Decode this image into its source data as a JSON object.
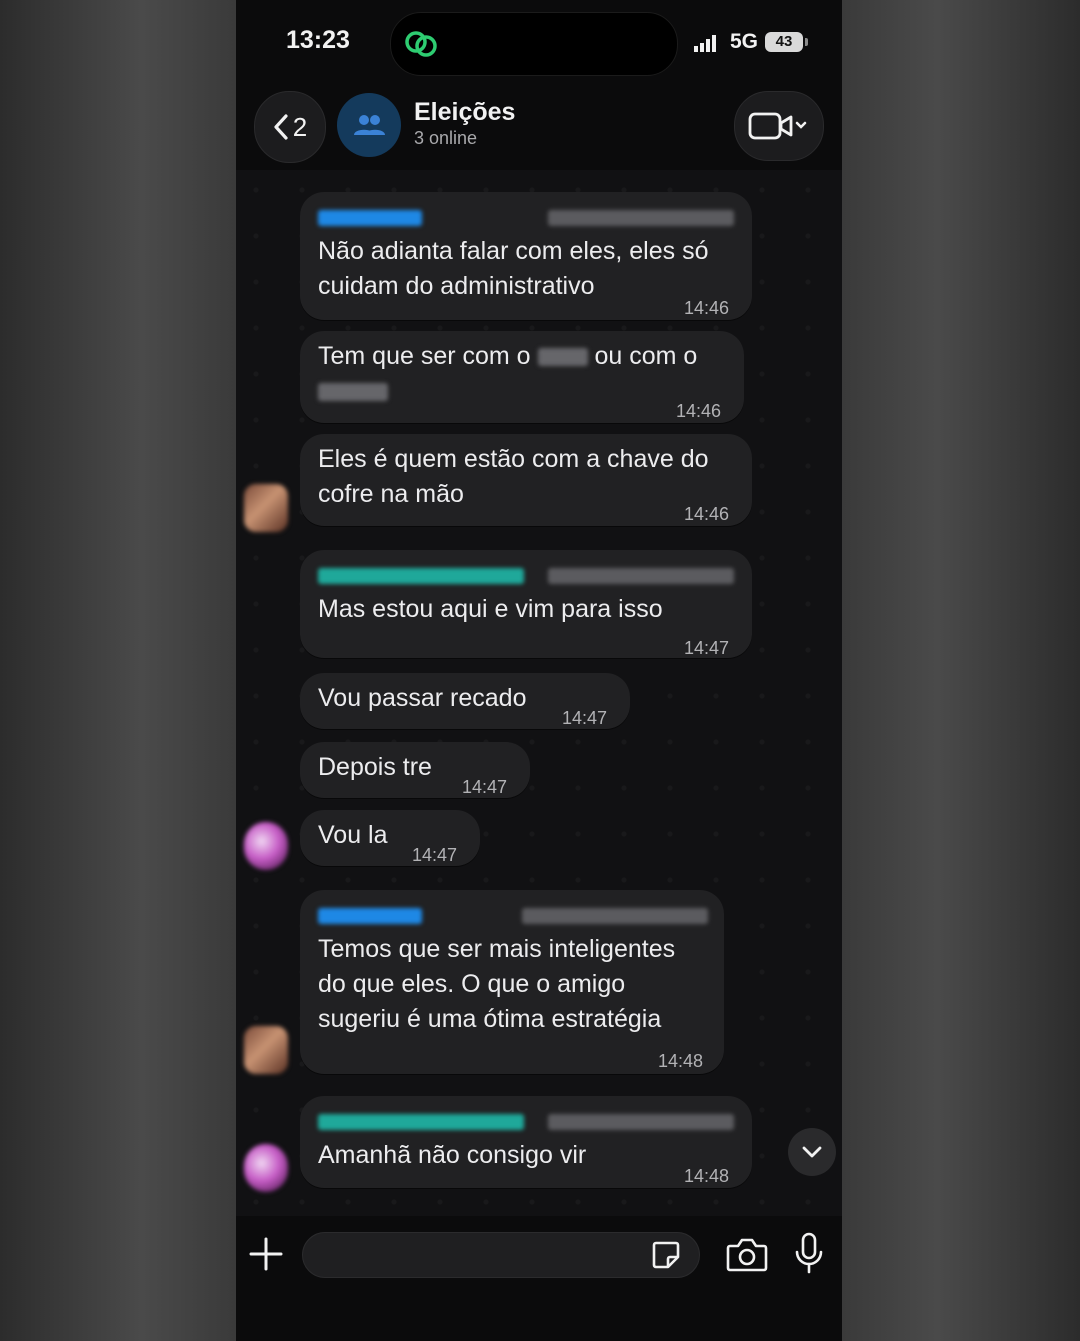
{
  "status_bar": {
    "time": "13:23",
    "network": "5G",
    "battery": "43"
  },
  "header": {
    "back_count": "2",
    "group_name": "Eleições",
    "group_status": "3 online"
  },
  "messages": [
    {
      "text_lines": [
        "Não adianta falar com eles, eles só",
        "cuidam do administrativo"
      ],
      "time": "14:46",
      "has_sender": true
    },
    {
      "text_line1_a": "Tem que ser com o",
      "text_line1_b": "ou com o",
      "time": "14:46"
    },
    {
      "text_lines": [
        "Eles é quem estão com a chave do",
        "cofre na mão"
      ],
      "time": "14:46"
    },
    {
      "text_lines": [
        "Mas estou aqui e vim para isso"
      ],
      "time": "14:47",
      "has_sender": true
    },
    {
      "text_lines": [
        "Vou passar recado"
      ],
      "time": "14:47"
    },
    {
      "text_lines": [
        "Depois tre"
      ],
      "time": "14:47"
    },
    {
      "text_lines": [
        "Vou la"
      ],
      "time": "14:47"
    },
    {
      "text_lines": [
        "Temos que ser mais inteligentes",
        "do que eles. O que o amigo",
        "sugeriu é uma ótima estratégia"
      ],
      "time": "14:48",
      "has_sender": true
    },
    {
      "text_lines": [
        "Amanhã não consigo vir"
      ],
      "time": "14:48",
      "has_sender": true
    }
  ],
  "input": {
    "placeholder": ""
  },
  "icons": {
    "island": "linked-rings-icon",
    "back": "chevron-left-icon",
    "group": "group-people-icon",
    "video": "video-camera-icon",
    "scroll": "chevron-down-icon",
    "plus": "plus-icon",
    "sticker": "sticker-icon",
    "camera": "camera-icon",
    "mic": "microphone-icon"
  },
  "colors": {
    "accent_blue": "#1e88e5",
    "sender_teal": "#1fa89a",
    "bubble": "#212123",
    "island_green": "#2ecc71"
  }
}
